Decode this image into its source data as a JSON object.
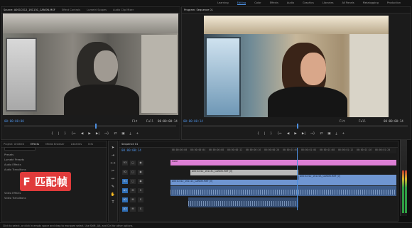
{
  "workspaces": {
    "items": [
      "Learning",
      "Editing",
      "Color",
      "Effects",
      "Audio",
      "Graphics",
      "Libraries",
      "All Panels",
      "Metalogging",
      "Production"
    ],
    "active_index": 1
  },
  "source_monitor": {
    "tabs": [
      "Source: A001C012_16113C_CANON.MXF",
      "Effect Controls",
      "Lumetri Scopes",
      "Audio Clip Mixer"
    ],
    "timecode_in": "00:00:00:00",
    "timecode_out": "00:00:00:14",
    "fit_label": "Fit",
    "zoom_label": "Full"
  },
  "program_monitor": {
    "tabs": [
      "Program: Sequence 01"
    ],
    "timecode_in": "00:00:00:14",
    "timecode_out": "00:00:00:14",
    "fit_label": "Fit",
    "zoom_label": "Full"
  },
  "controls": {
    "source": [
      "{",
      "|",
      "}",
      "{←",
      "◀",
      "▶",
      "▶|",
      "→}",
      "⇄",
      "▣",
      "⤓",
      "+"
    ],
    "program": [
      "{",
      "|",
      "}",
      "{←",
      "◀",
      "▶",
      "▶|",
      "→}",
      "⇄",
      "▣",
      "⤓",
      "+"
    ]
  },
  "project_panel": {
    "tabs": [
      "Project: Untitled",
      "Effects",
      "Media Browser",
      "Libraries",
      "Info"
    ],
    "tree": [
      "Presets",
      "Lumetri Presets",
      "Audio Effects",
      "Audio Transitions",
      "Video Effects",
      "Video Transitions"
    ],
    "badge": "F 匹配帧"
  },
  "timeline": {
    "tabs": [
      "Sequence 01"
    ],
    "timecode": "00:00:00:14",
    "ruler_labels": [
      "00:00:00:00",
      "00:00:00:04",
      "00:00:00:08",
      "00:00:00:12",
      "00:00:00:16",
      "00:00:00:20",
      "00:00:01:00",
      "00:00:01:04",
      "00:00:01:08",
      "00:00:01:12",
      "00:00:01:16",
      "00:00:01:20"
    ],
    "video_tracks": [
      "V3",
      "V2",
      "V1"
    ],
    "audio_tracks": [
      "A1",
      "A2",
      "A3"
    ],
    "clips": {
      "v3": "Color",
      "v2": "A001C012_16113C_CANON.MXF [V]",
      "v2b": "A001C012_16115A_CANON.MXF [V]",
      "v1": "A001C012_16111C_CANON.MXF [V]"
    }
  },
  "status_bar": "Click to select, or click in empty space and drag to marquee select. Use Shift, Alt, and Ctrl for other options."
}
